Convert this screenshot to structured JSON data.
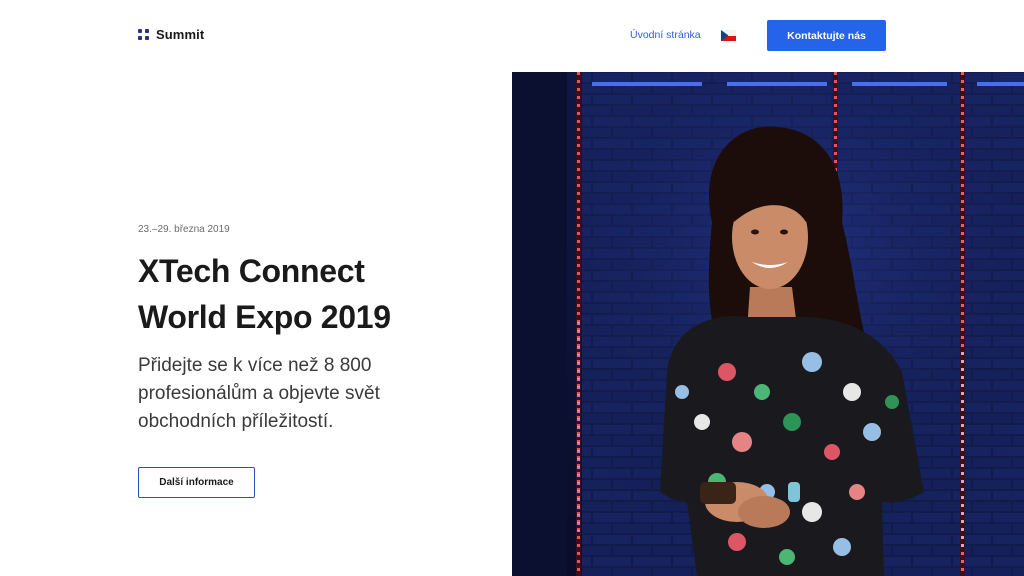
{
  "header": {
    "logo_text": "Summit",
    "nav_home": "Úvodní stránka",
    "language_flag": "czech-flag-icon",
    "contact_button": "Kontaktujte nás"
  },
  "hero": {
    "date": "23.–29. března 2019",
    "title_line1": "XTech Connect",
    "title_line2": "World Expo 2019",
    "subtitle": "Přidejte se k více než 8 800 profesionálům a objevte svět obchodních příležitostí.",
    "more_button": "Další informace"
  },
  "colors": {
    "accent": "#2563eb",
    "logo": "#2b2f8f",
    "link": "#2e5fe6"
  }
}
